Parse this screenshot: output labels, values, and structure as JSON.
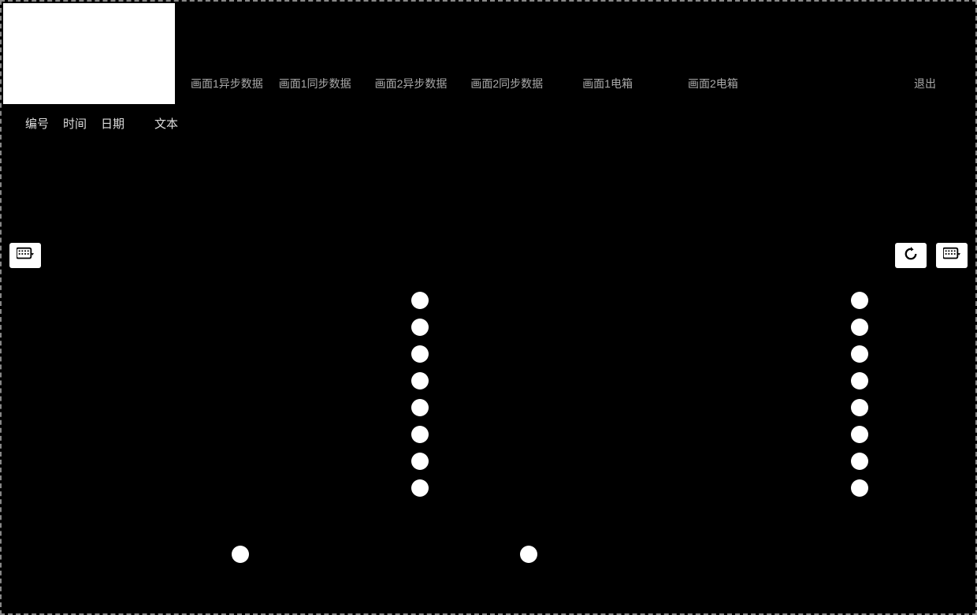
{
  "nav": {
    "items": [
      "画面1异步数据",
      "画面1同步数据",
      "画面2异步数据",
      "画面2同步数据",
      "画面1电箱",
      "画面2电箱"
    ],
    "exit": "退出"
  },
  "subnav": {
    "items": [
      "编号",
      "时间",
      "日期",
      "文本"
    ]
  },
  "indicators": {
    "left_column_count": 8,
    "right_column_count": 8,
    "bottom_left": true,
    "bottom_right": true
  }
}
